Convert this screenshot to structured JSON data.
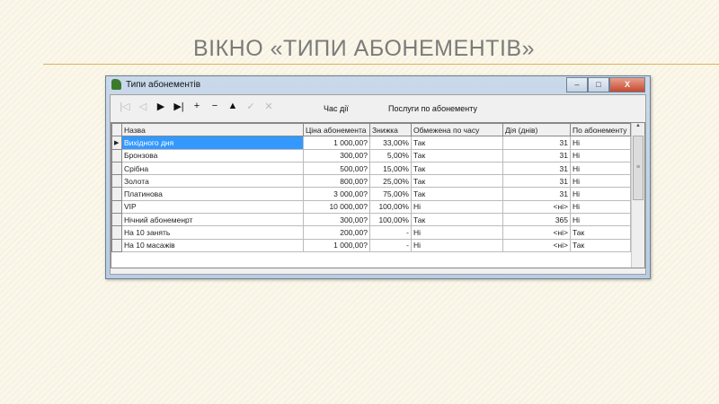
{
  "slide": {
    "title": "ВІКНО «ТИПИ АБОНЕМЕНТІВ»"
  },
  "window": {
    "title": "Типи абонементів",
    "minimize": "–",
    "maximize": "□",
    "close": "X"
  },
  "toolbar": {
    "buttons": [
      {
        "name": "first",
        "glyph": "|◁",
        "enabled": false
      },
      {
        "name": "prior",
        "glyph": "◁",
        "enabled": false
      },
      {
        "name": "next",
        "glyph": "▶",
        "enabled": true
      },
      {
        "name": "last",
        "glyph": "▶|",
        "enabled": true
      },
      {
        "name": "insert",
        "glyph": "+",
        "enabled": true
      },
      {
        "name": "delete",
        "glyph": "−",
        "enabled": true
      },
      {
        "name": "edit",
        "glyph": "▲",
        "enabled": true
      },
      {
        "name": "post",
        "glyph": "✓",
        "enabled": false
      },
      {
        "name": "cancel",
        "glyph": "✕",
        "enabled": false
      }
    ],
    "label1": "Час дії",
    "label2": "Послуги по абонементу"
  },
  "table": {
    "columns": [
      "Назва",
      "Ціна абонемента",
      "Знижка",
      "Обмежена по часу",
      "Дія (днів)",
      "По абонементу"
    ],
    "rows": [
      [
        "Вихідного дня",
        "1 000,00?",
        "33,00%",
        "Так",
        "31",
        "Ні"
      ],
      [
        "Бронзова",
        "300,00?",
        "5,00%",
        "Так",
        "31",
        "Ні"
      ],
      [
        "Срібна",
        "500,00?",
        "15,00%",
        "Так",
        "31",
        "Ні"
      ],
      [
        "Золота",
        "800,00?",
        "25,00%",
        "Так",
        "31",
        "Ні"
      ],
      [
        "Платинова",
        "3 000,00?",
        "75,00%",
        "Так",
        "31",
        "Ні"
      ],
      [
        "VIP",
        "10 000,00?",
        "100,00%",
        "Ні",
        "<ні>",
        "Ні"
      ],
      [
        "Нічний абонеменрт",
        "300,00?",
        "100,00%",
        "Так",
        "365",
        "Ні"
      ],
      [
        "На 10 занять",
        "200,00?",
        "-",
        "Ні",
        "<ні>",
        "Так"
      ],
      [
        "На 10 масажів",
        "1 000,00?",
        "-",
        "Ні",
        "<ні>",
        "Так"
      ]
    ],
    "selected_row": 0
  }
}
